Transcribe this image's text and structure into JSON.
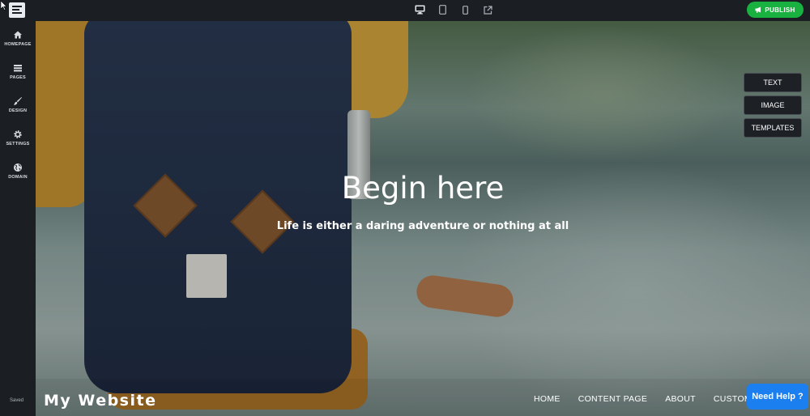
{
  "sidebar": {
    "items": [
      {
        "label": "HOMEPAGE",
        "icon": "home-icon"
      },
      {
        "label": "PAGES",
        "icon": "pages-icon"
      },
      {
        "label": "DESIGN",
        "icon": "brush-icon"
      },
      {
        "label": "SETTINGS",
        "icon": "gear-icon"
      },
      {
        "label": "DOMAIN",
        "icon": "globe-icon"
      }
    ],
    "status": "Saved"
  },
  "toolbar": {
    "publish_label": "PUBLISH",
    "devices": [
      "desktop-icon",
      "tablet-icon",
      "mobile-icon",
      "external-link-icon"
    ]
  },
  "hero": {
    "title": "Begin here",
    "subtitle": "Life is either a daring adventure or nothing at all"
  },
  "tools": {
    "text": "TEXT",
    "image": "IMAGE",
    "templates": "TEMPLATES"
  },
  "site": {
    "name": "My Website",
    "menu": [
      "HOME",
      "CONTENT PAGE",
      "ABOUT",
      "CUSTOM"
    ]
  },
  "help": {
    "label": "Need Help ?"
  },
  "colors": {
    "publish": "#19b13f",
    "help": "#1c7ff0",
    "chrome": "#1b1f23"
  }
}
